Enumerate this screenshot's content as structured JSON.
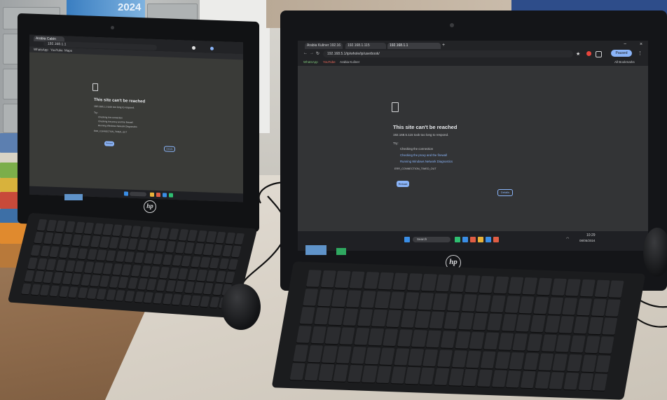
{
  "background": {
    "calendar_year": "2024"
  },
  "left_monitor": {
    "brand": "hp",
    "browser": {
      "tab_label": "Arabia Cabin",
      "address": "192.168.1.1",
      "bookmarks": [
        "WhatsApp",
        "YouTube",
        "Maps"
      ]
    },
    "error": {
      "title": "This site can't be reached",
      "subtitle": "192.168.1.1 took too long to respond.",
      "try_label": "Try:",
      "suggestions": [
        "Checking the connection",
        "Checking the proxy and the firewall",
        "Running Windows Network Diagnostics"
      ],
      "code": "ERR_CONNECTION_TIMED_OUT",
      "reload_label": "Reload",
      "details_label": "Details"
    }
  },
  "right_monitor": {
    "brand": "hp",
    "browser": {
      "tabs": [
        {
          "label": "Arabia Kuliner 192.16"
        },
        {
          "label": "192.168.1.115"
        },
        {
          "label": "192.168.1.1"
        }
      ],
      "address": "192.168.5.1/ip/whole/ip/userbook/",
      "bookmarks": [
        "WhatsApp",
        "YouTube",
        "Arabia Kuliner"
      ],
      "all_bookmarks": "All Bookmarks",
      "profile_button": "Paused"
    },
    "error": {
      "title": "This site can't be reached",
      "subtitle": "192.168.5.115 took too long to respond.",
      "try_label": "Try:",
      "suggestions": [
        {
          "text": "Checking the connection",
          "link": false
        },
        {
          "text": "Checking the proxy and the firewall",
          "link": true
        },
        {
          "text": "Running Windows Network Diagnostics",
          "link": true
        }
      ],
      "code": "ERR_CONNECTION_TIMED_OUT",
      "reload_label": "Reload",
      "details_label": "Details"
    },
    "taskbar": {
      "search_label": "Search",
      "clock_time": "10:29",
      "clock_date": "08/05/2024"
    }
  }
}
